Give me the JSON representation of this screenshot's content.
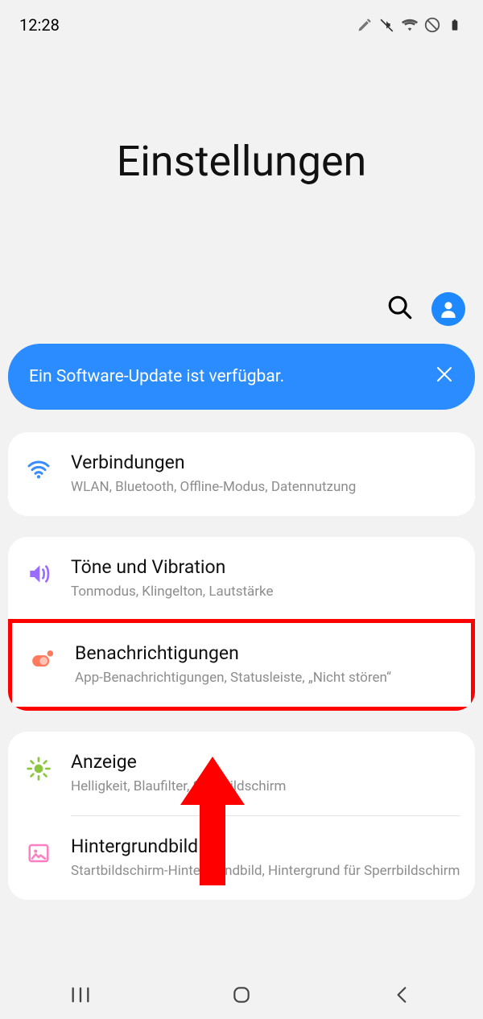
{
  "status": {
    "time": "12:28"
  },
  "header": {
    "title": "Einstellungen"
  },
  "banner": {
    "text": "Ein Software-Update ist verfügbar."
  },
  "cards": [
    {
      "rows": [
        {
          "icon": "wifi",
          "color": "#3a8bff",
          "title": "Verbindungen",
          "sub": "WLAN, Bluetooth, Offline-Modus, Datennutzung"
        }
      ]
    },
    {
      "rows": [
        {
          "icon": "sound",
          "color": "#9a6cff",
          "title": "Töne und Vibration",
          "sub": "Tonmodus, Klingelton, Lautstärke"
        },
        {
          "icon": "notif",
          "color": "#ff7a5c",
          "title": "Benachrichtigungen",
          "sub": "App-Benachrichtigungen, Statusleiste, „Nicht stören“",
          "highlight": true
        }
      ]
    },
    {
      "rows": [
        {
          "icon": "bright",
          "color": "#8cc63f",
          "title": "Anzeige",
          "sub": "Helligkeit, Blaufilter, Startbildschirm"
        },
        {
          "icon": "wall",
          "color": "#ff7ec1",
          "title": "Hintergrundbild",
          "sub": "Startbildschirm-Hintergrundbild, Hintergrund für Sperrbildschirm"
        }
      ]
    }
  ]
}
